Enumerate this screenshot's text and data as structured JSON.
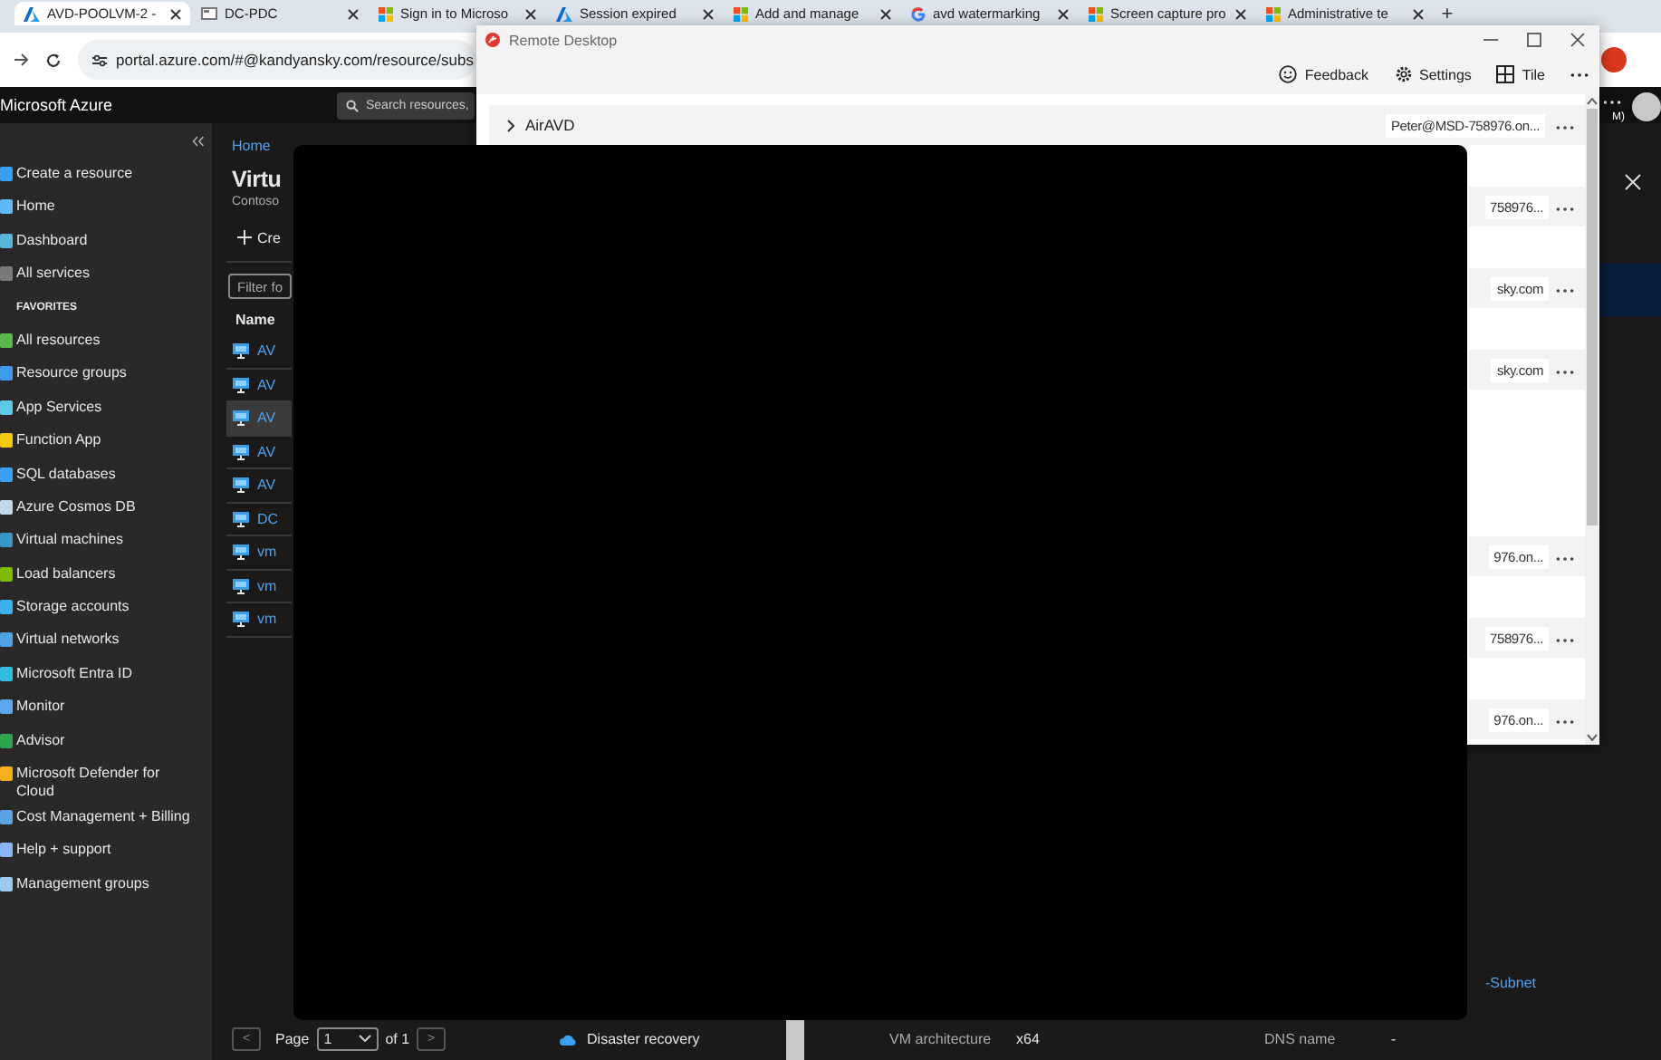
{
  "browser": {
    "tabs": [
      {
        "title": "AVD-POOLVM-2 -",
        "kind": "azure",
        "selected": true
      },
      {
        "title": "DC-PDC",
        "kind": "page",
        "selected": false
      },
      {
        "title": "Sign in to Microso",
        "kind": "microsoft",
        "selected": false
      },
      {
        "title": "Session expired",
        "kind": "azure",
        "selected": false
      },
      {
        "title": "Add and manage",
        "kind": "microsoft",
        "selected": false
      },
      {
        "title": "avd watermarking",
        "kind": "google",
        "selected": false
      },
      {
        "title": "Screen capture pro",
        "kind": "microsoft",
        "selected": false
      },
      {
        "title": "Administrative te",
        "kind": "microsoft",
        "selected": false
      }
    ],
    "new_tab": "+",
    "url": "portal.azure.com/#@kandyansky.com/resource/subs"
  },
  "portal": {
    "brand": "Microsoft Azure",
    "search": {
      "placeholder": "Search resources,"
    },
    "account": "M)"
  },
  "sidebar": {
    "items": [
      {
        "label": "Create a resource",
        "kind": "item"
      },
      {
        "label": "Home",
        "kind": "item"
      },
      {
        "label": "Dashboard",
        "kind": "item"
      },
      {
        "label": "All services",
        "kind": "item"
      },
      {
        "label": "FAVORITES",
        "kind": "heading"
      },
      {
        "label": "All resources",
        "kind": "item"
      },
      {
        "label": "Resource groups",
        "kind": "item"
      },
      {
        "label": "App Services",
        "kind": "item"
      },
      {
        "label": "Function App",
        "kind": "item"
      },
      {
        "label": "SQL databases",
        "kind": "item"
      },
      {
        "label": "Azure Cosmos DB",
        "kind": "item"
      },
      {
        "label": "Virtual machines",
        "kind": "item"
      },
      {
        "label": "Load balancers",
        "kind": "item"
      },
      {
        "label": "Storage accounts",
        "kind": "item"
      },
      {
        "label": "Virtual networks",
        "kind": "item"
      },
      {
        "label": "Microsoft Entra ID",
        "kind": "item"
      },
      {
        "label": "Monitor",
        "kind": "item"
      },
      {
        "label": "Advisor",
        "kind": "item"
      },
      {
        "label": "Microsoft Defender for Cloud",
        "kind": "item"
      },
      {
        "label": "Cost Management + Billing",
        "kind": "item"
      },
      {
        "label": "Help + support",
        "kind": "item"
      },
      {
        "label": "Management groups",
        "kind": "item"
      }
    ]
  },
  "main": {
    "breadcrumb": "Home",
    "title": "Virtu",
    "subtitle": "Contoso",
    "create": "Cre",
    "filter": {
      "placeholder": "Filter fo"
    },
    "columns": [
      "Name"
    ],
    "rows": [
      {
        "name": "AV",
        "selected": false
      },
      {
        "name": "AV",
        "selected": false
      },
      {
        "name": "AV",
        "selected": true
      },
      {
        "name": "AV",
        "selected": false
      },
      {
        "name": "AV",
        "selected": false
      },
      {
        "name": "DC",
        "selected": false
      },
      {
        "name": "vm",
        "selected": false
      },
      {
        "name": "vm",
        "selected": false
      },
      {
        "name": "vm",
        "selected": false
      }
    ],
    "subnet_link": "-Subnet",
    "pager": {
      "previous": "<",
      "label": "Page",
      "page": "1",
      "of": "of 1",
      "next": ">"
    },
    "disaster_recovery": "Disaster recovery",
    "properties": [
      {
        "label": "VM architecture",
        "value": "x64"
      },
      {
        "label": "DNS name",
        "value": "-"
      }
    ]
  },
  "remote_desktop": {
    "title": "Remote Desktop",
    "toolbar": [
      {
        "label": "Feedback",
        "kind": "feedback"
      },
      {
        "label": "Settings",
        "kind": "settings"
      },
      {
        "label": "Tile",
        "kind": "tile"
      }
    ],
    "groups": [
      {
        "name": "AirAVD",
        "rows": [
          {
            "user": "Peter@MSD-758976.on..."
          },
          {
            "user": "758976..."
          },
          {
            "user": "sky.com"
          },
          {
            "user": "sky.com"
          }
        ]
      },
      {
        "rows": [
          {
            "user": "976.on..."
          },
          {
            "user": "758976..."
          },
          {
            "user": "976.on..."
          }
        ]
      }
    ]
  }
}
